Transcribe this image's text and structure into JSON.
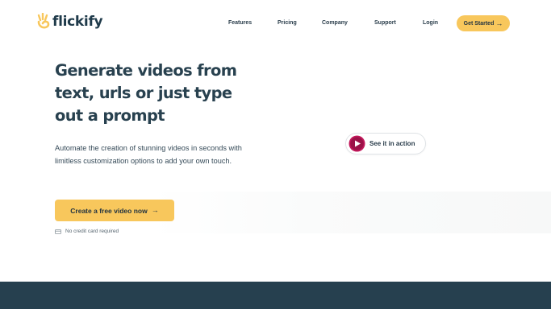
{
  "brand": {
    "name": "flickify",
    "accent": "#f8c75c",
    "dark": "#26404f",
    "play_color": "#c2185b"
  },
  "nav": {
    "links": [
      {
        "label": "Features"
      },
      {
        "label": "Pricing"
      },
      {
        "label": "Company"
      },
      {
        "label": "Support"
      },
      {
        "label": "Login"
      }
    ],
    "cta": {
      "label": "Get Started",
      "icon": "arrow-right-icon"
    }
  },
  "hero": {
    "title": "Generate videos from text, urls or just type out a prompt",
    "subtitle": "Automate the creation of stunning videos in seconds with limitless customization options to add your own touch.",
    "cta": {
      "label": "Create a free video now",
      "icon": "arrow-right-icon"
    },
    "note": {
      "label": "No credit card required",
      "icon": "credit-card-icon"
    },
    "video_button": {
      "label": "See it in action",
      "icon": "play-icon"
    }
  }
}
